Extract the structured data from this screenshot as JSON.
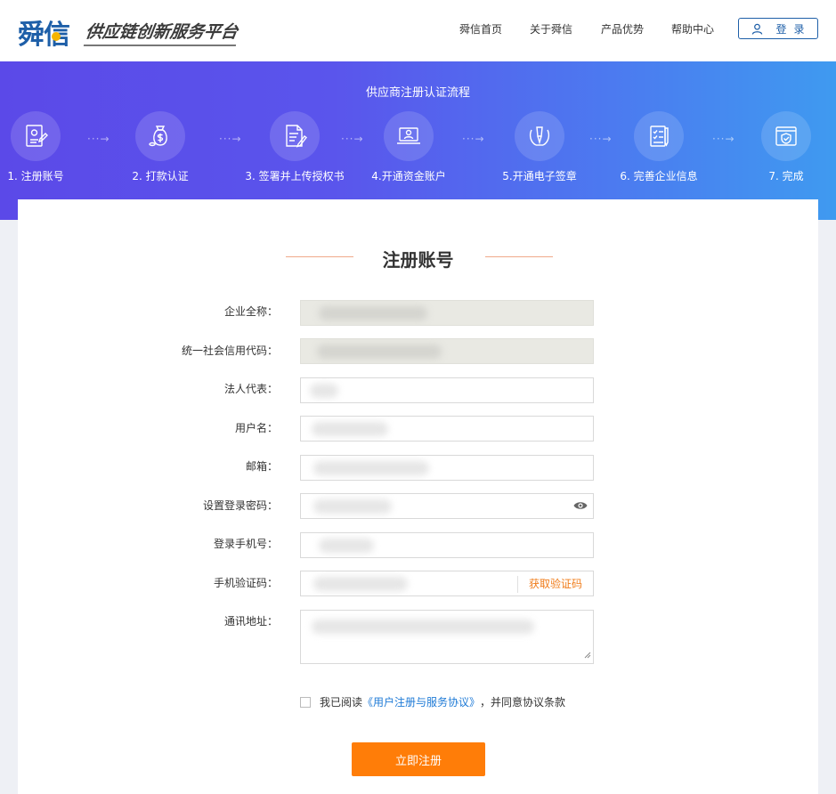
{
  "header": {
    "logo_text": "舜信",
    "slogan": "供应链创新服务平台",
    "nav": [
      "舜信首页",
      "关于舜信",
      "产品优势",
      "帮助中心"
    ],
    "login_label": "登录"
  },
  "banner": {
    "title": "供应商注册认证流程",
    "steps": [
      {
        "label": "1. 注册账号",
        "icon": "register-document-icon"
      },
      {
        "label": "2. 打款认证",
        "icon": "money-bag-icon"
      },
      {
        "label": "3. 签署并上传授权书",
        "icon": "sign-document-icon"
      },
      {
        "label": "4.开通资金账户",
        "icon": "account-laptop-icon"
      },
      {
        "label": "5.开通电子签章",
        "icon": "seal-pen-icon"
      },
      {
        "label": "6. 完善企业信息",
        "icon": "checklist-icon"
      },
      {
        "label": "7. 完成",
        "icon": "shield-check-icon"
      }
    ]
  },
  "form": {
    "title": "注册账号",
    "fields": [
      {
        "label": "企业全称：",
        "value": "",
        "readonly": true
      },
      {
        "label": "统一社会信用代码：",
        "value": "",
        "readonly": true
      },
      {
        "label": "法人代表：",
        "value": ""
      },
      {
        "label": "用户名：",
        "value": ""
      },
      {
        "label": "邮箱：",
        "value": ""
      },
      {
        "label": "设置登录密码：",
        "value": ""
      },
      {
        "label": "登录手机号：",
        "value": ""
      },
      {
        "label": "手机验证码：",
        "value": ""
      },
      {
        "label": "通讯地址：",
        "value": ""
      }
    ],
    "get_code_label": "获取验证码",
    "agree_prefix": "我已阅读",
    "agree_link": "《用户注册与服务协议》",
    "agree_suffix": "，并同意协议条款",
    "submit_label": "立即注册"
  },
  "colors": {
    "brand_blue": "#1e5fa8",
    "accent_orange": "#ff7d08",
    "banner_start": "#5b49e8",
    "banner_end": "#3f9af0"
  }
}
